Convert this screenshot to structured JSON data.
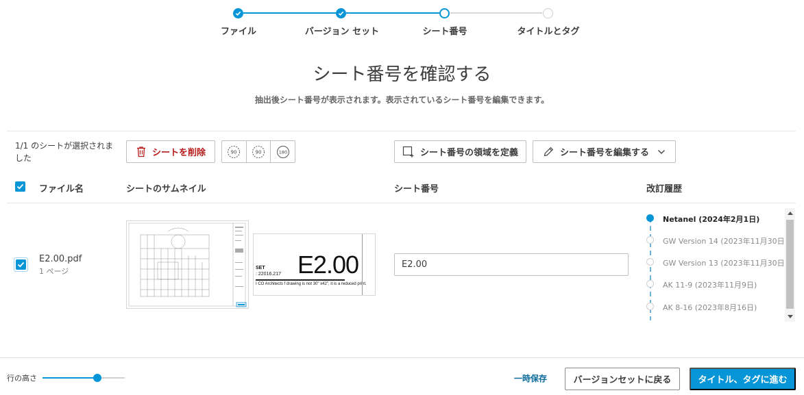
{
  "stepper": {
    "steps": [
      {
        "label": "ファイル",
        "state": "done"
      },
      {
        "label": "バージョン セット",
        "state": "done"
      },
      {
        "label": "シート番号",
        "state": "current"
      },
      {
        "label": "タイトルとタグ",
        "state": "todo"
      }
    ]
  },
  "header": {
    "title": "シート番号を確認する",
    "subtitle": "抽出後シート番号が表示されます。表示されているシート番号を編集できます。"
  },
  "toolbar": {
    "selection_count": "1/1 のシートが選択されました",
    "delete_label": "シートを削除",
    "rotate_ccw_label": "90",
    "rotate_cw_label": "90",
    "rotate_180_label": "180",
    "define_region_label": "シート番号の領域を定義",
    "edit_label": "シート番号を編集する"
  },
  "table": {
    "columns": {
      "file_name": "ファイル名",
      "thumbnail": "シートのサムネイル",
      "sheet_number": "シート番号",
      "revision_history": "改訂履歴"
    },
    "rows": [
      {
        "checked": true,
        "file_name": "E2.00.pdf",
        "pages": "1 ページ",
        "thumb_sheet_number": "E2.00",
        "thumb_set": "SET",
        "thumb_number": ": 22016.217",
        "thumb_note": "I  CO Architects  f drawing is not 30\" x42\", it is a reduced print.",
        "sheet_number_value": "E2.00",
        "revisions": [
          {
            "label": "Netanel (2024年2月1日)",
            "active": true
          },
          {
            "label": "GW Version 14 (2023年11月30日)",
            "active": false
          },
          {
            "label": "GW Version 13 (2023年11月30日)",
            "active": false
          },
          {
            "label": "AK 11-9 (2023年11月9日)",
            "active": false
          },
          {
            "label": "AK 8-16 (2023年8月16日)",
            "active": false
          }
        ]
      }
    ]
  },
  "footer": {
    "row_height_label": "行の高さ",
    "row_height_value": 0.67,
    "save_draft_label": "一時保存",
    "back_label": "バージョンセットに戻る",
    "next_label": "タイトル、タグに進む"
  },
  "colors": {
    "accent": "#0696d7",
    "danger": "#b71c1c",
    "link": "#0b6a9c"
  }
}
